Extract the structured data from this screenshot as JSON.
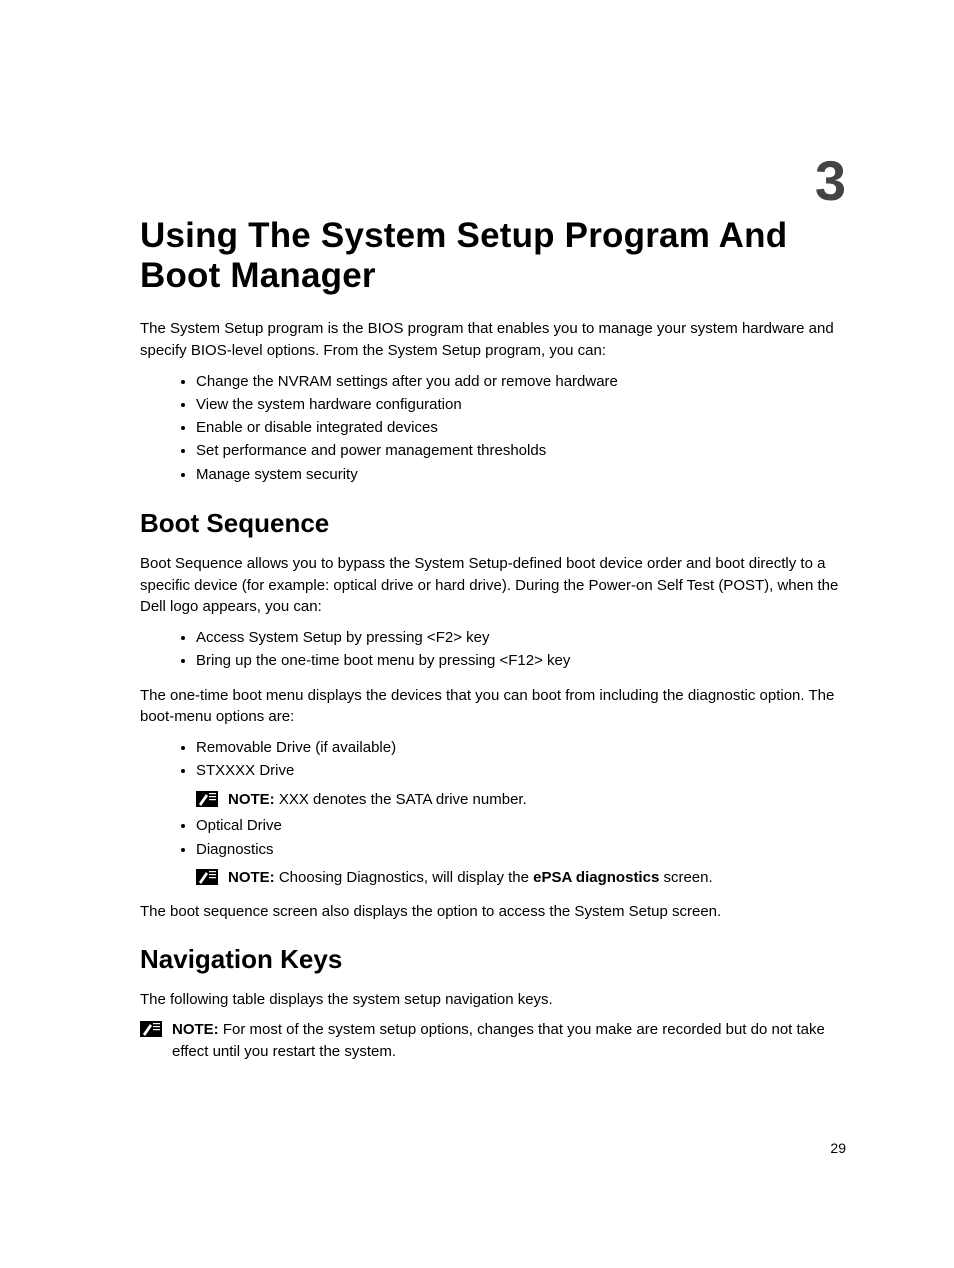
{
  "chapter_number": "3",
  "title": "Using The System Setup Program And Boot Manager",
  "intro": "The System Setup program is the BIOS program that enables you to manage your system hardware and specify BIOS-level options. From the System Setup program, you can:",
  "intro_list": [
    "Change the NVRAM settings after you add or remove hardware",
    "View the system hardware configuration",
    "Enable or disable integrated devices",
    "Set performance and power management thresholds",
    "Manage system security"
  ],
  "section_boot_heading": "Boot Sequence",
  "boot_para1": "Boot Sequence allows you to bypass the System Setup-defined boot device order and boot directly to a specific device (for example: optical drive or hard drive). During the Power-on Self Test (POST), when the Dell logo appears, you can:",
  "boot_list1": [
    "Access System Setup by pressing <F2> key",
    "Bring up the one-time boot menu by pressing <F12> key"
  ],
  "boot_para2": "The one-time boot menu displays the devices that you can boot from including the diagnostic option. The boot-menu options are:",
  "boot_list2_item1": "Removable Drive (if available)",
  "boot_list2_item2": "STXXXX Drive",
  "note1_label": "NOTE: ",
  "note1_text": "XXX denotes the SATA drive number.",
  "boot_list2_item3": "Optical Drive",
  "boot_list2_item4": "Diagnostics",
  "note2_label": "NOTE: ",
  "note2_pre": "Choosing Diagnostics, will display the ",
  "note2_bold": "ePSA diagnostics",
  "note2_post": " screen.",
  "boot_para3": "The boot sequence screen also displays the option to access the System Setup screen.",
  "section_nav_heading": "Navigation Keys",
  "nav_para1": "The following table displays the system setup navigation keys.",
  "note3_label": "NOTE: ",
  "note3_text": "For most of the system setup options, changes that you make are recorded but do not take effect until you restart the system.",
  "page_number": "29"
}
